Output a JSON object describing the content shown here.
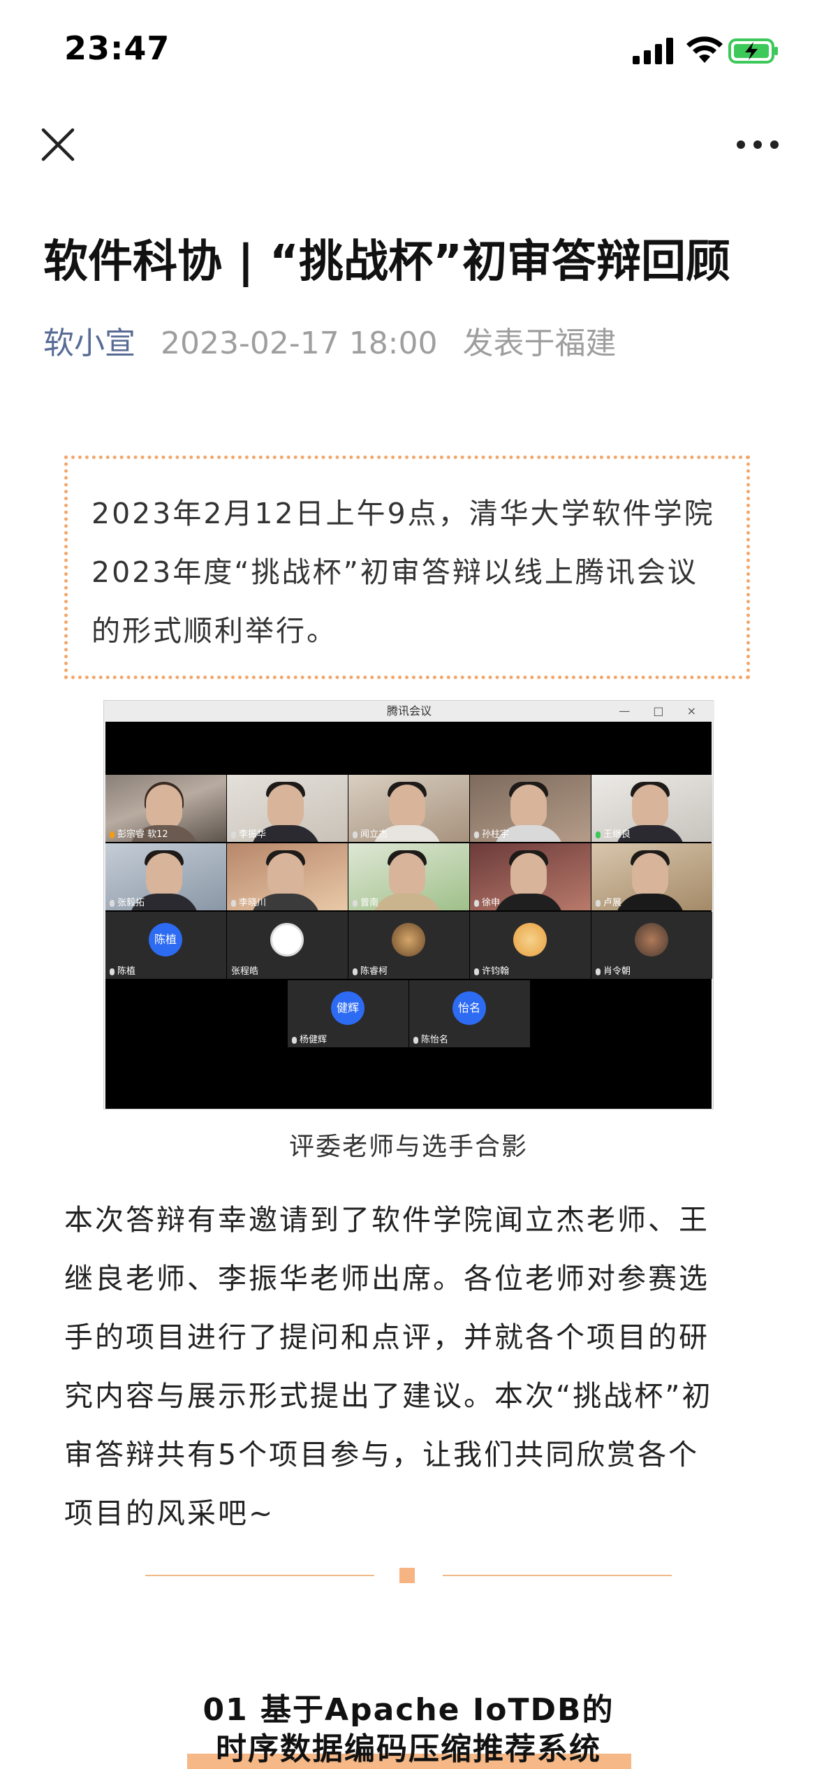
{
  "status_bar": {
    "time": "23:47"
  },
  "article": {
    "title": "软件科协 | “挑战杯”初审答辩回顾",
    "author": "软小宣",
    "date": "2023-02-17 18:00",
    "location": "发表于福建",
    "intro_lines": [
      "2023年2月12日上午9点，清华大学软件学院",
      "2023年度“挑战杯”初审答辩以线上腾讯会议",
      "的形式顺利举行。"
    ],
    "meeting": {
      "window_title": "腾讯会议",
      "window_controls": "— □ ×",
      "participants_row1": [
        "彭宗睿 软12",
        "李振华",
        "闻立杰",
        "孙柱宇",
        "王继良"
      ],
      "participants_row2": [
        "张毅拓",
        "李晓川",
        "曾南",
        "徐申",
        "卢展"
      ],
      "participants_row3": [
        "陈植",
        "张程皓",
        "陈睿柯",
        "许钧翰",
        "肖令朝"
      ],
      "participants_row4": [
        "杨健辉",
        "陈怡名"
      ],
      "avatar_text_1": "陈植",
      "avatar_text_2": "健辉",
      "avatar_text_3": "怡名"
    },
    "image_caption": "评委老师与选手合影",
    "body_lines": [
      "本次答辩有幸邀请到了软件学院闻立杰老师、王",
      "继良老师、李振华老师出席。各位老师对参赛选",
      "手的项目进行了提问和点评，并就各个项目的研",
      "究内容与展示形式提出了建议。本次“挑战杯”初",
      "审答辩共有5个项目参与，让我们共同欣赏各个",
      "项目的风采吧~"
    ],
    "section_heading_line1": "01  基于Apache IoTDB的",
    "section_heading_line2": "时序数据编码压缩推荐系统"
  },
  "colors": {
    "accent": "#f2a66a",
    "author": "#576b95",
    "meta": "#9e9e9e"
  },
  "icons": [
    "close-icon",
    "more-icon",
    "signal-icon",
    "wifi-icon",
    "battery-icon",
    "mic-icon"
  ]
}
